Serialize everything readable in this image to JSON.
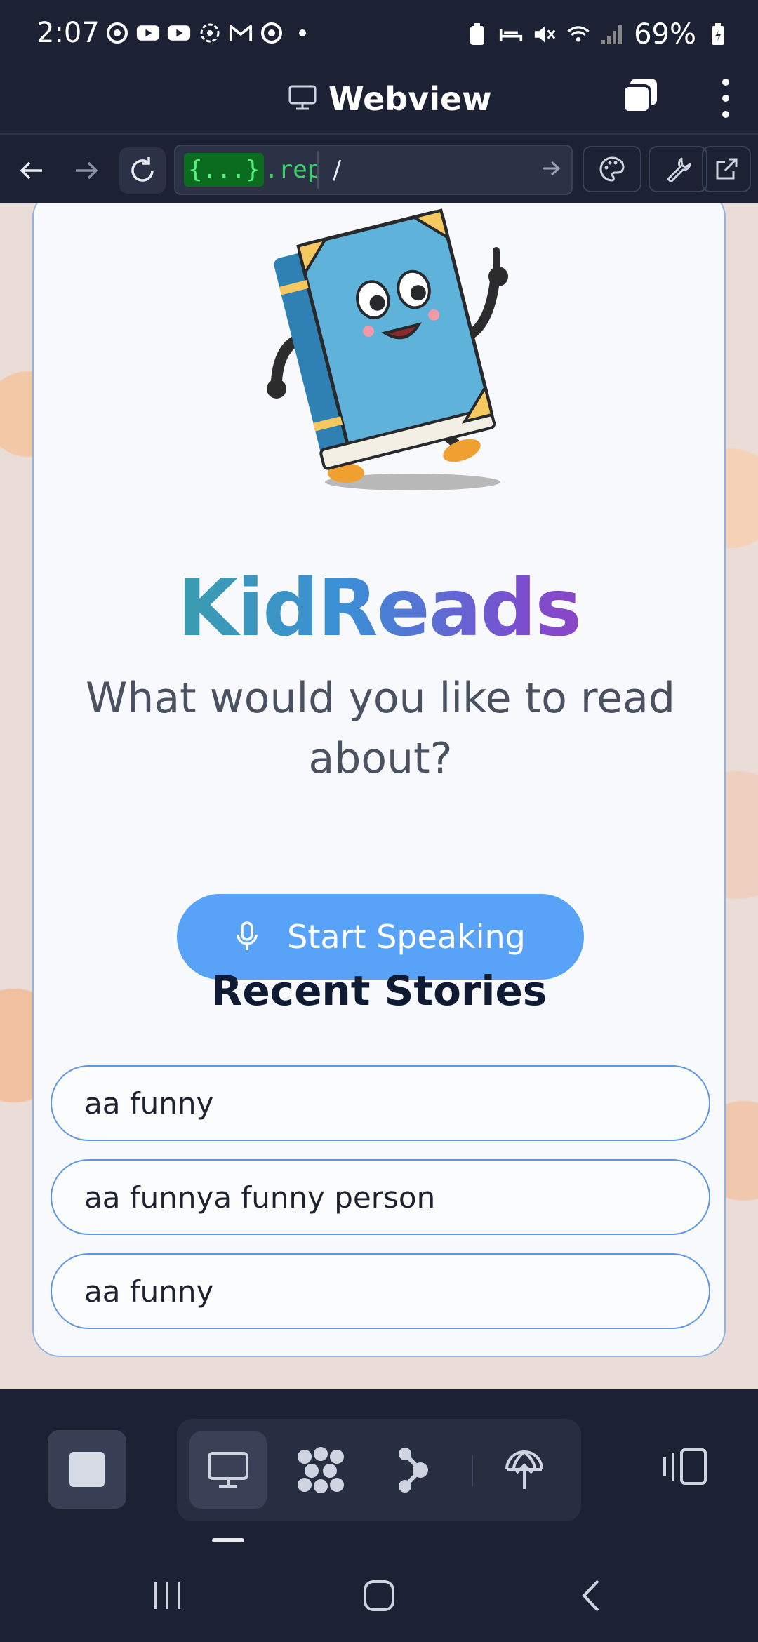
{
  "status_bar": {
    "time": "2:07",
    "battery_text": "69%"
  },
  "webview": {
    "title": "Webview"
  },
  "url_bar": {
    "host_braces": "{...}",
    "host_domain": ".replit.",
    "path": "/"
  },
  "app": {
    "brand": "KidReads",
    "question": "What would you like to read about?",
    "speak_button": "Start Speaking",
    "recent_title": "Recent Stories",
    "stories": [
      {
        "label": "aa funny"
      },
      {
        "label": "aa funnya funny person"
      },
      {
        "label": "aa funny"
      }
    ]
  },
  "colors": {
    "accent_button": "#58a2f7",
    "story_border": "#5d98e0",
    "chrome_bg": "#1c2233"
  },
  "icons": {
    "mic": "microphone-icon",
    "tabs": "tabs-icon",
    "menu": "kebab-menu-icon"
  }
}
